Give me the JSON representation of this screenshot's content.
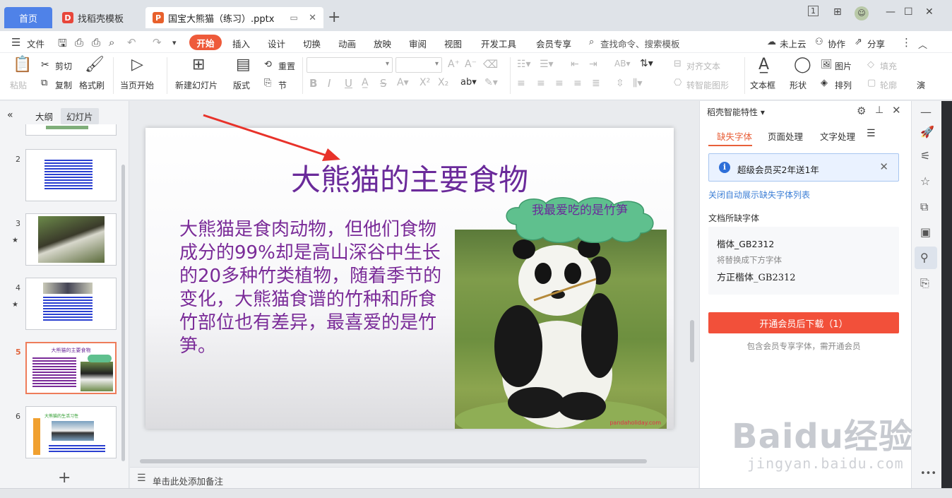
{
  "tabs": {
    "home": "首页",
    "template": "找稻壳模板",
    "doc": "国宝大熊猫（练习）.pptx"
  },
  "window": {
    "page_indicator": "1"
  },
  "menu": {
    "file": "文件",
    "start": "开始",
    "insert": "插入",
    "design": "设计",
    "transition": "切换",
    "animation": "动画",
    "slideshow": "放映",
    "review": "审阅",
    "view": "视图",
    "devtools": "开发工具",
    "member": "会员专享",
    "search": "查找命令、搜索模板",
    "cloud": "未上云",
    "collab": "协作",
    "share": "分享"
  },
  "ribbon": {
    "paste": "粘贴",
    "cut": "剪切",
    "copy": "复制",
    "format_painter": "格式刷",
    "from_current": "当页开始",
    "new_slide": "新建幻灯片",
    "layout": "版式",
    "reset": "重置",
    "section": "节",
    "align_text": "对齐文本",
    "smart_shape": "转智能图形",
    "textbox": "文本框",
    "shape": "形状",
    "picture": "图片",
    "arrange": "排列",
    "fill": "填充",
    "outline": "轮廓",
    "present": "演"
  },
  "left_panel": {
    "tab_outline": "大纲",
    "tab_slides": "幻灯片",
    "slide_numbers": [
      "2",
      "3",
      "4",
      "5",
      "6"
    ],
    "thumb5_title": "大熊猫的主要食物",
    "thumb6_title": "大熊猫的生活习性"
  },
  "slide": {
    "title": "大熊猫的主要食物",
    "body": "大熊猫是食肉动物，但他们食物成分的99%却是高山深谷中生长的20多种竹类植物，随着季节的变化，大熊猫食谱的竹种和所食竹部位也有差异，最喜爱的是竹笋。",
    "bubble": "我最爱吃的是竹笋",
    "photo_credit": "pandaholiday.com"
  },
  "notes": {
    "placeholder": "单击此处添加备注"
  },
  "smart_panel": {
    "title": "稻壳智能特性",
    "tab_font": "缺失字体",
    "tab_page": "页面处理",
    "tab_text": "文字处理",
    "notice": "超级会员买2年送1年",
    "close_auto": "关闭自动展示缺失字体列表",
    "missing_label": "文档所缺字体",
    "missing_font": "楷体_GB2312",
    "replace_label": "将替换成下方字体",
    "replace_font": "方正楷体_GB2312",
    "download_button": "开通会员后下载（1）",
    "download_note": "包含会员专享字体，需开通会员"
  },
  "watermark": {
    "main": "Baidu经验",
    "sub": "jingyan.baidu.com"
  },
  "colors": {
    "accent": "#ee5a3a",
    "title_purple": "#6a2a9a",
    "link_blue": "#3d7fd6",
    "cloud_green": "#5fc08e"
  }
}
